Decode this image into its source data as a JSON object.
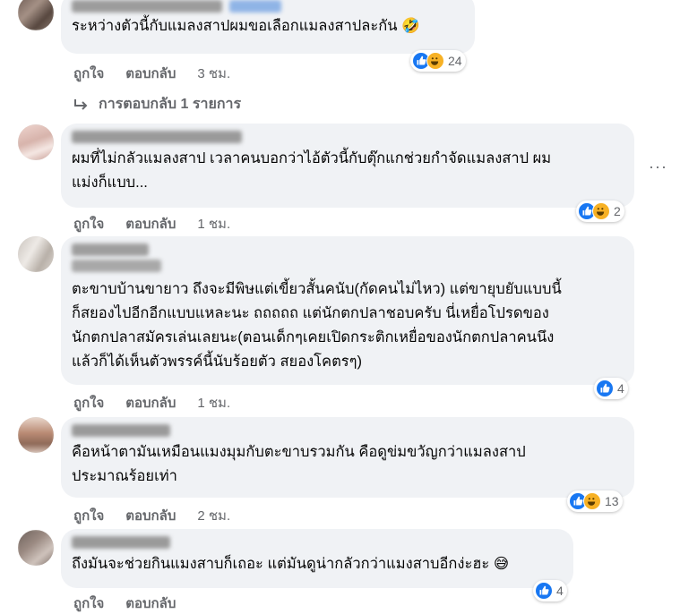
{
  "comments": [
    {
      "text": "ระหว่างตัวนี้กับแมลงสาปผมขอเลือกแมลงสาปละกัน 🤣",
      "like_label": "ถูกใจ",
      "reply_label": "ตอบกลับ",
      "time": "3 ชม.",
      "reaction_count": "24",
      "reactions": [
        "like",
        "haha"
      ]
    },
    {
      "text": "ผมที่ไม่กลัวแมลงสาป เวลาคนบอกว่าไอ้ตัวนี้กับตุ๊กแกช่วยกำจัดแมลงสาป ผม\nแม่งก็แบบ...",
      "like_label": "ถูกใจ",
      "reply_label": "ตอบกลับ",
      "time": "1 ชม.",
      "reaction_count": "2",
      "reactions": [
        "like",
        "haha"
      ],
      "more_label": "···"
    },
    {
      "text": "ตะขาบบ้านขายาว ถึงจะมีพิษแต่เขี้ยวสั้นคนับ(กัดคนไม่ไหว) แต่ขายุบยับแบบนี้\nก็สยองไปอีกอีกแบบแหละนะ ถถถถถ แต่นักตกปลาชอบครับ นี่เหยื่อโปรดของ\nนักตกปลาสมัครเล่นเลยนะ(ตอนเด็กๆเคยเปิดกระติกเหยื่อของนักตกปลาคนนึง\nแล้วก็ได้เห็นตัวพรรค์นี้นับร้อยตัว สยองโคตรๆ)",
      "like_label": "ถูกใจ",
      "reply_label": "ตอบกลับ",
      "time": "1 ชม.",
      "reaction_count": "4",
      "reactions": [
        "like"
      ]
    },
    {
      "text": "คือหน้าตามันเหมือนแมงมุมกับตะขาบรวมกัน คือดูข่มขวัญกว่าแมลงสาป\nประมาณร้อยเท่า",
      "like_label": "ถูกใจ",
      "reply_label": "ตอบกลับ",
      "time": "2 ชม.",
      "reaction_count": "13",
      "reactions": [
        "like",
        "haha"
      ]
    },
    {
      "text": "ถึงมันจะช่วยกินแมงสาบก็เถอะ แต่มันดูน่ากลัวกว่าแมงสาบอีกง่ะฮะ 😅",
      "like_label": "ถูกใจ",
      "reply_label": "ตอบกลับ",
      "time": "",
      "reaction_count": "4",
      "reactions": [
        "like"
      ]
    }
  ],
  "replies_link": "การตอบกลับ 1 รายการ",
  "colors": {
    "bubble": "#f0f2f5",
    "like": "#1877f2",
    "haha": "#f7b125",
    "meta": "#65676b"
  }
}
